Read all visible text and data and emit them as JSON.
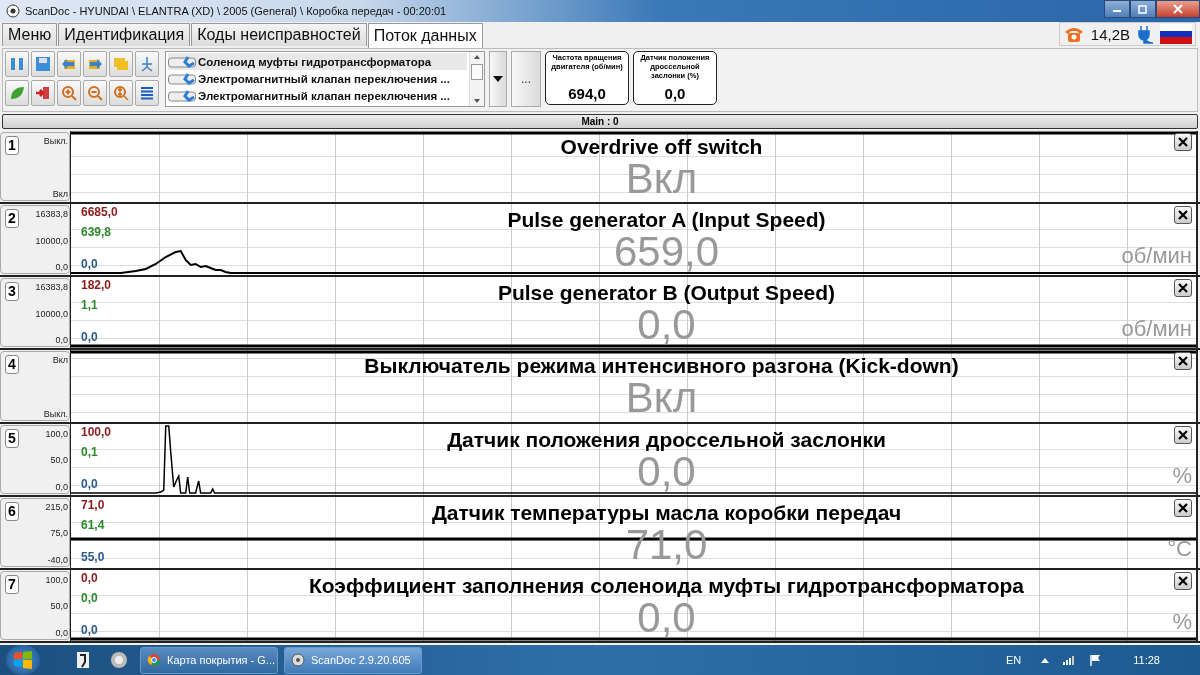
{
  "window": {
    "title": "ScanDoc - HYUNDAI \\ ELANTRA (XD) \\ 2005 (General) \\ Коробка передач - 00:20:01"
  },
  "tabs": [
    {
      "label": "Меню",
      "selected": false
    },
    {
      "label": "Идентификация",
      "selected": false
    },
    {
      "label": "Коды неисправностей",
      "selected": false
    },
    {
      "label": "Поток данных",
      "selected": true
    }
  ],
  "parameter_list": [
    {
      "label": "Соленоид муфты гидротрансформатора",
      "selected": true
    },
    {
      "label": "Электромагнитный клапан переключения ...",
      "selected": false
    },
    {
      "label": "Электромагнитный клапан переключения ...",
      "selected": false
    }
  ],
  "more_button": "...",
  "gauges": [
    {
      "label": "Частота вращения двигателя  (об/мин)",
      "value": "694,0"
    },
    {
      "label": "Датчик положения дроссельной заслонки  (%)",
      "value": "0,0"
    }
  ],
  "status": {
    "voltage": "14,2В"
  },
  "section_bar": "Main : 0",
  "channels": [
    {
      "number": "1",
      "axis": [
        "Выкл.",
        "Вкл"
      ],
      "title": "Overdrive off switch",
      "value": "Вкл",
      "kind": "high"
    },
    {
      "number": "2",
      "axis": [
        "16383,8",
        "10000,0",
        "0,0"
      ],
      "max": "6685,0",
      "avg": "639,8",
      "min": "0,0",
      "title": "Pulse generator A (Input Speed)",
      "value": "659,0",
      "unit": "об/мин",
      "kind": "bump"
    },
    {
      "number": "3",
      "axis": [
        "16383,8",
        "10000,0",
        "0,0"
      ],
      "max": "182,0",
      "avg": "1,1",
      "min": "0,0",
      "title": "Pulse generator B (Output Speed)",
      "value": "0,0",
      "unit": "об/мин",
      "kind": "low"
    },
    {
      "number": "4",
      "axis": [
        "Вкл",
        "Выкл."
      ],
      "title": "Выключатель режима интенсивного разгона (Kick-down)",
      "value": "Вкл",
      "kind": "high"
    },
    {
      "number": "5",
      "axis": [
        "100,0",
        "50,0",
        "0,0"
      ],
      "max": "100,0",
      "avg": "0,1",
      "min": "0,0",
      "title": "Датчик положения дроссельной заслонки",
      "value": "0,0",
      "unit": "%",
      "kind": "spikes"
    },
    {
      "number": "6",
      "axis": [
        "215,0",
        "75,0",
        "-40,0"
      ],
      "max": "71,0",
      "avg": "61,4",
      "min": "55,0",
      "title": "Датчик температуры масла коробки передач",
      "value": "71,0",
      "unit": "°C",
      "kind": "middle"
    },
    {
      "number": "7",
      "axis": [
        "100,0",
        "50,0",
        "0,0"
      ],
      "max": "0,0",
      "avg": "0,0",
      "min": "0,0",
      "title": "Коэффициент заполнения соленоида муфты гидротрансформатора",
      "value": "0,0",
      "unit": "%",
      "kind": "low"
    }
  ],
  "taskbar": {
    "tasks": [
      {
        "label": "Карта покрытия - G...",
        "selected": false
      },
      {
        "label": "ScanDoc 2.9.20.605",
        "selected": true
      }
    ],
    "language": "EN",
    "clock": "11:28"
  }
}
